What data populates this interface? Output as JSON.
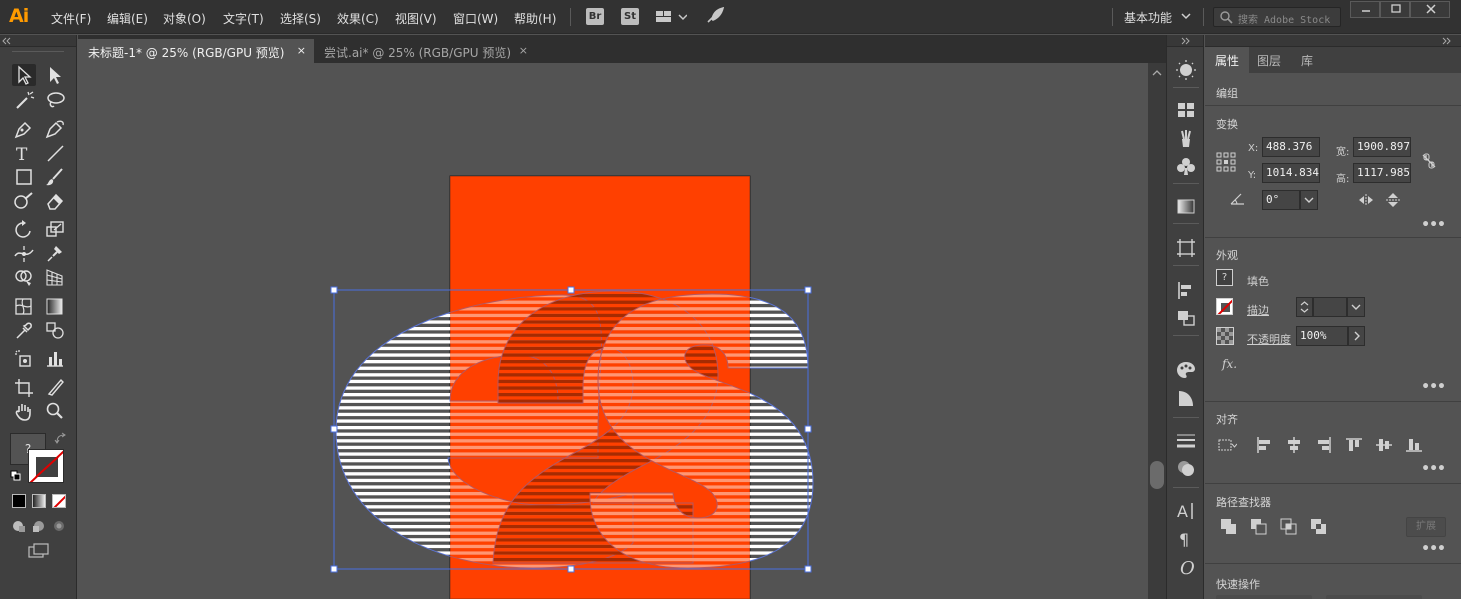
{
  "app": {
    "logo": "Ai",
    "accent": "#ff9a00"
  },
  "menu": {
    "items": [
      "文件(F)",
      "编辑(E)",
      "对象(O)",
      "文字(T)",
      "选择(S)",
      "效果(C)",
      "视图(V)",
      "窗口(W)",
      "帮助(H)"
    ],
    "bridge_label": "Br",
    "stock_label": "St",
    "workspace": "基本功能",
    "search_placeholder": "搜索 Adobe Stock"
  },
  "tabs": [
    {
      "label": "未标题-1* @ 25% (RGB/GPU 预览)",
      "close": "×"
    },
    {
      "label": "尝试.ai* @ 25% (RGB/GPU 预览)",
      "close": "×"
    }
  ],
  "toolbar": {
    "fill_stroke_question": "?",
    "icons": [
      "selection-tool",
      "direct-selection-tool",
      "magic-wand-tool",
      "lasso-tool",
      "pen-tool",
      "curvature-tool",
      "type-tool",
      "line-tool",
      "rectangle-tool",
      "paintbrush-tool",
      "shaper-tool",
      "eraser-tool",
      "rotate-tool",
      "scale-tool",
      "width-tool",
      "puppet-warp-tool",
      "shape-builder-tool",
      "perspective-grid-tool",
      "mesh-tool",
      "gradient-tool",
      "eyedropper-tool",
      "blend-tool",
      "symbol-sprayer-tool",
      "column-graph-tool",
      "artboard-tool",
      "slice-tool",
      "hand-tool",
      "zoom-tool"
    ]
  },
  "artwork": {
    "artboard_color": "#ff4000",
    "letters": "e2s",
    "selection_color": "#4a6fe0"
  },
  "properties": {
    "tabs": [
      "属性",
      "图层",
      "库"
    ],
    "group_label": "编组",
    "transform": {
      "title": "变换",
      "x_label": "X:",
      "x_value": "488.376",
      "y_label": "Y:",
      "y_value": "1014.834",
      "w_label": "宽:",
      "w_value": "1900.897",
      "h_label": "高:",
      "h_value": "1117.985",
      "angle_value": "0°"
    },
    "appearance": {
      "title": "外观",
      "fill_label": "填色",
      "fill_question": "?",
      "stroke_label": "描边",
      "opacity_label": "不透明度",
      "opacity_value": "100%",
      "fx_label": "fx."
    },
    "align": {
      "title": "对齐"
    },
    "pathfinder": {
      "title": "路径查找器",
      "expand_label": "扩展"
    },
    "quick_actions": {
      "title": "快速操作"
    },
    "more_label": "•••"
  }
}
